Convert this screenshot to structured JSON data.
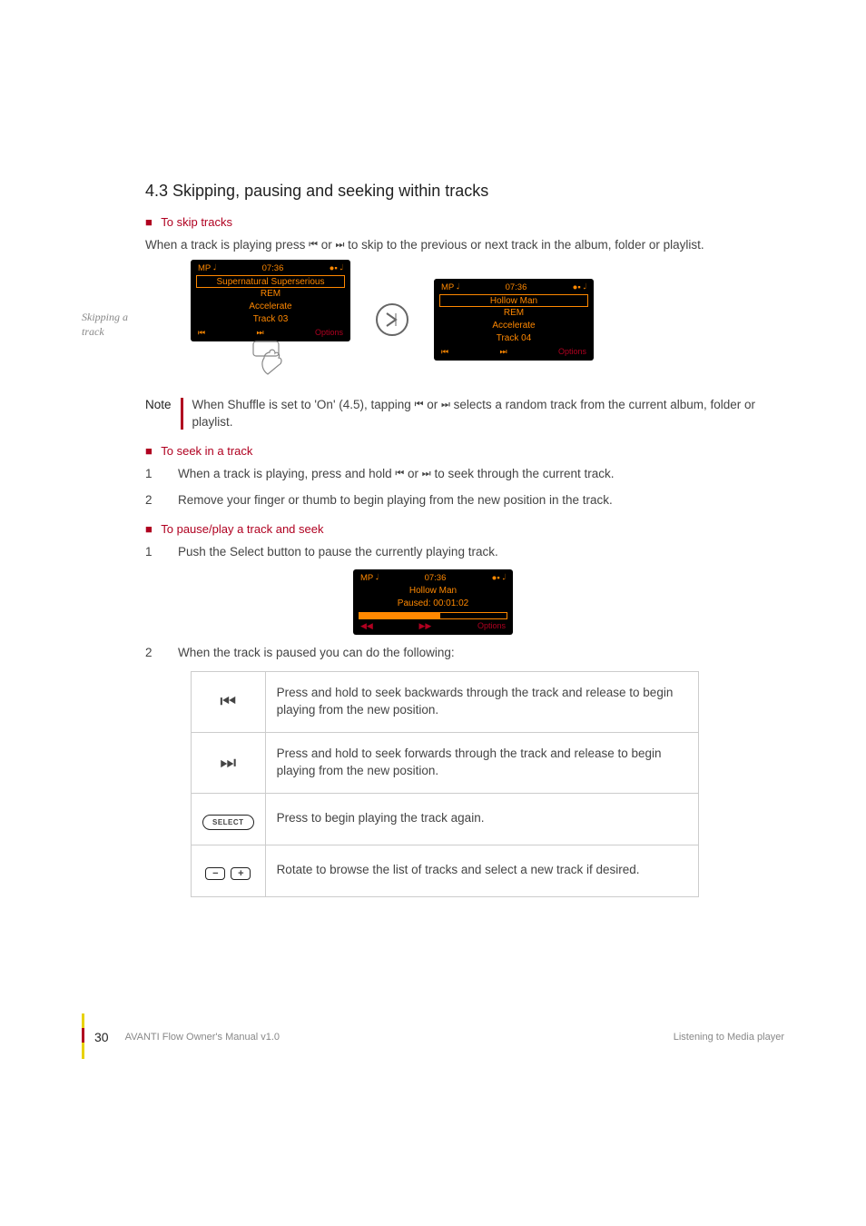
{
  "heading": "4.3  Skipping, pausing and seeking within tracks",
  "margin_note": "Skipping a track",
  "skip": {
    "title": "To skip tracks",
    "intro_a": "When a track is playing press ",
    "intro_b": " or ",
    "intro_c": " to skip to the previous or next track in the album, folder or playlist."
  },
  "screen1": {
    "mp": "MP",
    "time": "07:36",
    "title": "Supernatural Superserious",
    "artist": "REM",
    "album": "Accelerate",
    "track": "Track 03",
    "options": "Options"
  },
  "screen2": {
    "mp": "MP",
    "time": "07:36",
    "title": "Hollow Man",
    "artist": "REM",
    "album": "Accelerate",
    "track": "Track 04",
    "options": "Options"
  },
  "note": {
    "label": "Note",
    "text_a": "When Shuffle is set to 'On' (4.5), tapping ",
    "text_b": " or ",
    "text_c": "  selects a random track from the current album, folder or playlist."
  },
  "seek": {
    "title": "To seek in a track",
    "step1_a": "When a track is playing, press and hold ",
    "step1_b": " or ",
    "step1_c": " to seek through the current track.",
    "step2": "Remove your finger or thumb to begin playing from the new position in the track."
  },
  "pause": {
    "title": "To pause/play a track and seek",
    "step1": "Push the Select button to pause the currently playing track.",
    "step2": "When the track is paused you can do the following:"
  },
  "screen3": {
    "mp": "MP",
    "time": "07:36",
    "title": "Hollow Man",
    "paused": "Paused: 00:01:02",
    "options": "Options"
  },
  "table": {
    "r1": "Press and hold to seek backwards through the track and release to begin playing from the new position.",
    "r2": "Press and hold to seek forwards through the track and release to begin playing from the new position.",
    "r3": "Press to begin playing the track again.",
    "r4": "Rotate to browse the list of tracks and select a new track if desired.",
    "select_label": "SELECT",
    "minus": "−",
    "plus": "+"
  },
  "footer": {
    "page": "30",
    "title": "AVANTI Flow Owner's Manual v1.0",
    "section": "Listening to Media player"
  },
  "step_nums": {
    "n1": "1",
    "n2": "2"
  }
}
